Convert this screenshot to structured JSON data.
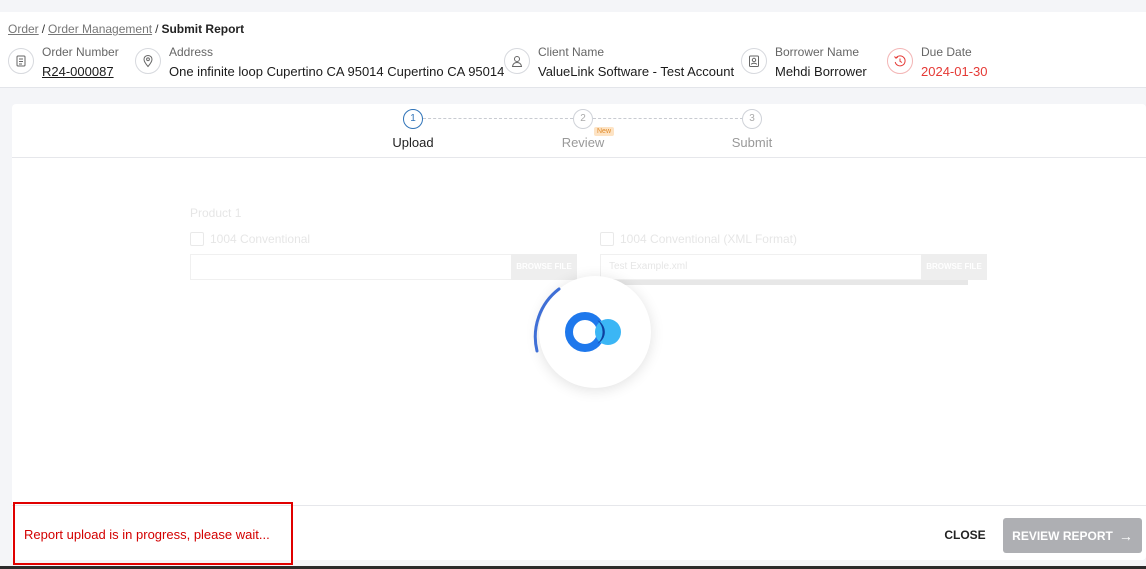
{
  "breadcrumb": {
    "items": [
      "Order",
      "Order Management"
    ],
    "current": "Submit Report"
  },
  "order_info": {
    "order_number": {
      "label": "Order Number",
      "value": "R24-000087"
    },
    "address": {
      "label": "Address",
      "value": "One infinite loop Cupertino CA 95014 Cupertino CA 95014"
    },
    "client": {
      "label": "Client Name",
      "value": "ValueLink Software - Test Account"
    },
    "borrower": {
      "label": "Borrower Name",
      "value": "Mehdi Borrower"
    },
    "due_date": {
      "label": "Due Date",
      "value": "2024-01-30",
      "color": "#e53935"
    }
  },
  "stepper": {
    "steps": [
      {
        "num": "1",
        "label": "Upload",
        "state": "active"
      },
      {
        "num": "2",
        "label": "Review",
        "state": "pending"
      },
      {
        "num": "3",
        "label": "Submit",
        "state": "pending"
      }
    ],
    "badge": "New"
  },
  "form": {
    "product_label": "Product 1",
    "files": [
      {
        "label": "1004 Conventional",
        "value": "",
        "button": "BROWSE FILE"
      },
      {
        "label": "1004 Conventional (XML Format)",
        "value": "Test Example.xml",
        "button": "BROWSE FILE"
      }
    ]
  },
  "footer": {
    "status_message": "Report upload is in progress, please wait...",
    "close_label": "CLOSE",
    "review_label": "REVIEW REPORT",
    "status_color": "#d30000"
  },
  "icons": [
    "clipboard-icon",
    "location-pin-icon",
    "user-icon",
    "id-badge-icon",
    "clock-history-icon",
    "file-icon",
    "loading-spinner-icon",
    "arrow-right-icon"
  ]
}
